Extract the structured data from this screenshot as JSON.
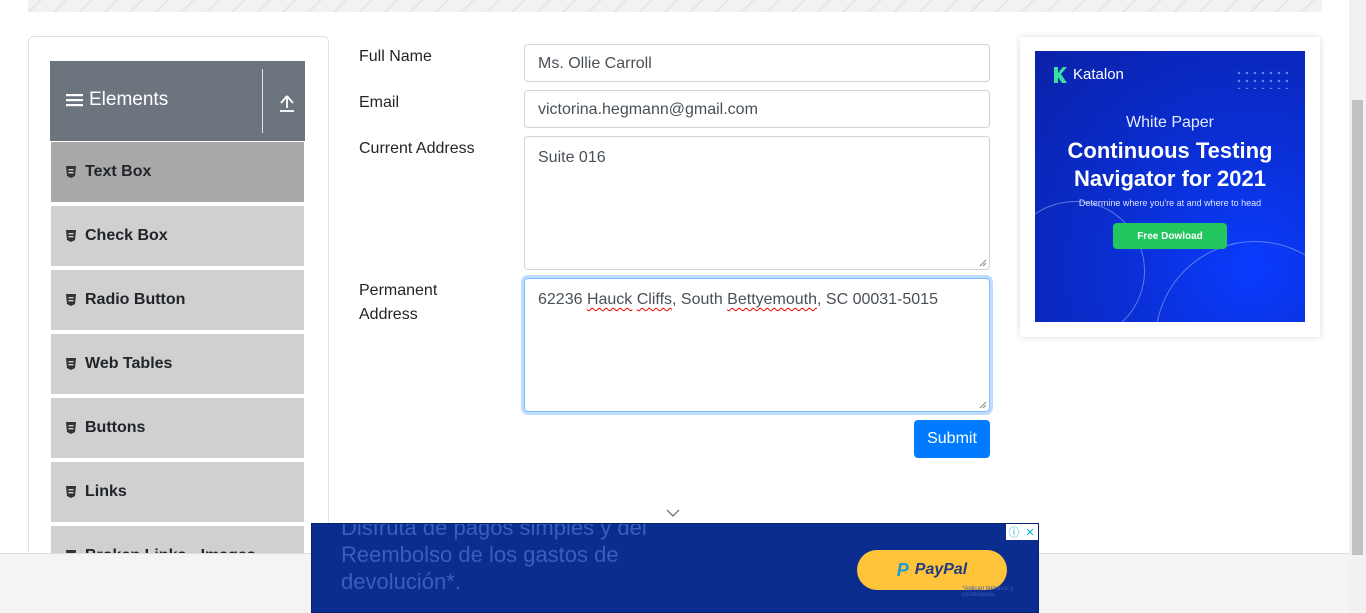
{
  "sidebar": {
    "group_title": "Elements",
    "items": [
      {
        "label": "Text Box",
        "active": true
      },
      {
        "label": "Check Box"
      },
      {
        "label": "Radio Button"
      },
      {
        "label": "Web Tables"
      },
      {
        "label": "Buttons"
      },
      {
        "label": "Links"
      },
      {
        "label": "Broken Links - Images"
      }
    ]
  },
  "form": {
    "full_name_label": "Full Name",
    "full_name_value": "Ms. Ollie Carroll",
    "email_label": "Email",
    "email_value": "victorina.hegmann@gmail.com",
    "current_address_label": "Current Address",
    "current_address_value": "Suite 016",
    "permanent_address_label_1": "Permanent",
    "permanent_address_label_2": "Address",
    "permanent_address_parts": [
      "62236 ",
      "Hauck",
      " ",
      "Cliffs",
      ", South ",
      "Bettyemouth",
      ", SC 00031-5015"
    ],
    "submit_label": "Submit"
  },
  "side_ad": {
    "brand": "Katalon",
    "kicker": "White Paper",
    "headline_1": "Continuous Testing",
    "headline_2": "Navigator for 2021",
    "subtitle": "Determine where you're at and where to head",
    "cta": "Free Dowload",
    "accent": "#22c55e"
  },
  "banner_ad": {
    "line_1": "Disfruta de pagos simples y del",
    "line_2": "Reembolso de los gastos de",
    "line_3": "devolución*.",
    "paypal_label": "PayPal",
    "fine_print": "*Aplican términos y condiciones."
  },
  "colors": {
    "primary": "#007bff",
    "sidebar_header": "#6c757d",
    "menu_item": "#d0d0d0",
    "menu_item_active": "#a9a9a9"
  }
}
